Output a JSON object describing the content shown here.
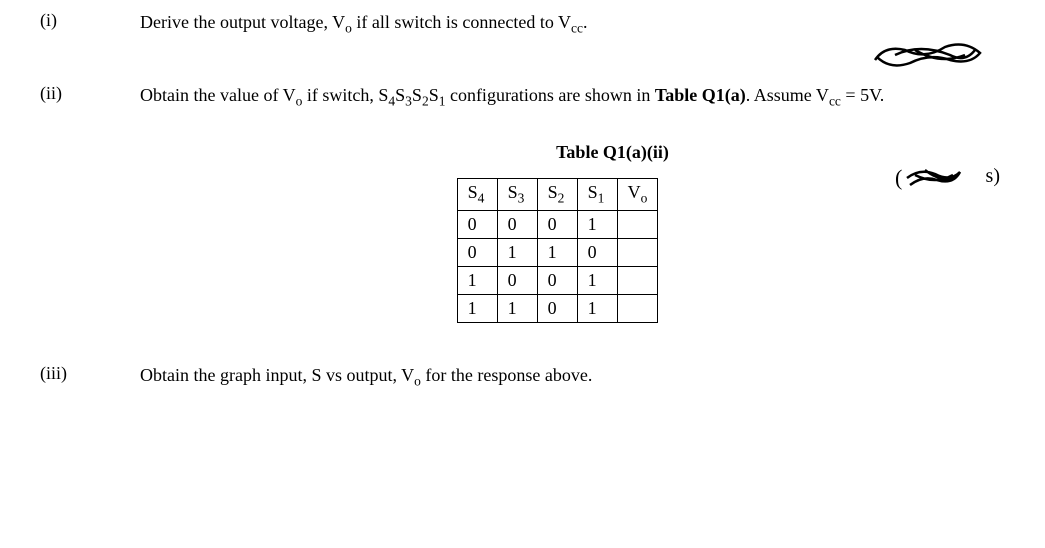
{
  "questions": {
    "i": {
      "label": "(i)",
      "text_parts": [
        "Derive the output voltage, V",
        " if all switch is connected to V",
        "."
      ],
      "subscripts": [
        "o",
        "cc"
      ]
    },
    "ii": {
      "label": "(ii)",
      "text_parts": [
        "Obtain the value of V",
        " if switch, S",
        "S",
        "S",
        "S",
        " configurations are shown in ",
        ". Assume V",
        " = 5V."
      ],
      "subscripts": [
        "o",
        "4",
        "3",
        "2",
        "1",
        "cc"
      ],
      "table_ref": "Table Q1(a)",
      "marks_tail": "s)"
    },
    "iii": {
      "label": "(iii)",
      "text_parts": [
        "Obtain the graph input, S vs output, V",
        " for the response above."
      ],
      "subscripts": [
        "o"
      ]
    }
  },
  "table": {
    "title": "Table Q1(a)(ii)",
    "headers": {
      "s4": "S",
      "s4_sub": "4",
      "s3": "S",
      "s3_sub": "3",
      "s2": "S",
      "s2_sub": "2",
      "s1": "S",
      "s1_sub": "1",
      "vo": "V",
      "vo_sub": "o"
    },
    "rows": [
      {
        "s4": "0",
        "s3": "0",
        "s2": "0",
        "s1": "1",
        "vo": ""
      },
      {
        "s4": "0",
        "s3": "1",
        "s2": "1",
        "s1": "0",
        "vo": ""
      },
      {
        "s4": "1",
        "s3": "0",
        "s2": "0",
        "s1": "1",
        "vo": ""
      },
      {
        "s4": "1",
        "s3": "1",
        "s2": "0",
        "s1": "1",
        "vo": ""
      }
    ]
  }
}
